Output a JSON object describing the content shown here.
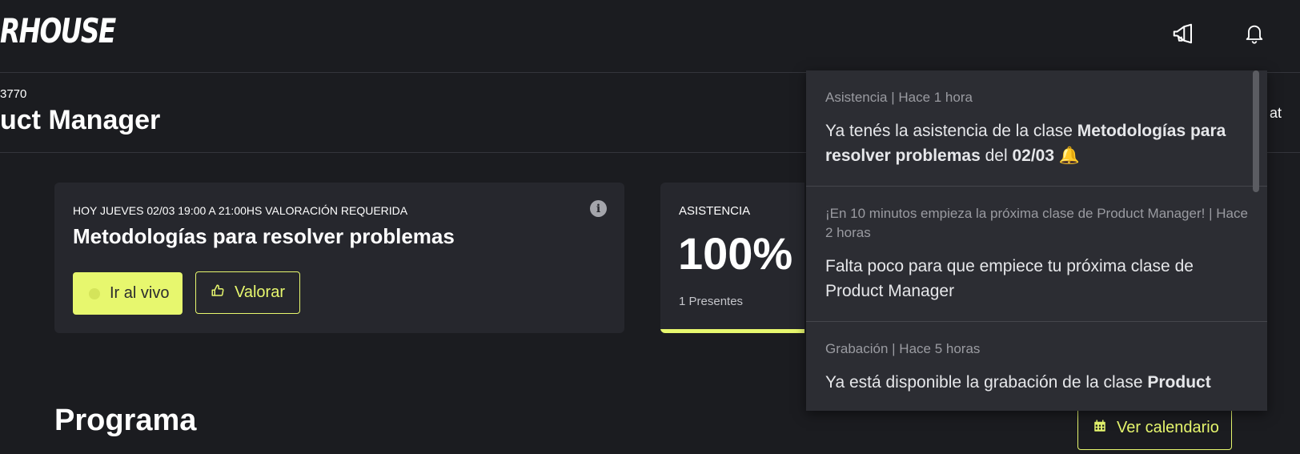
{
  "header": {
    "logo": "RHOUSE"
  },
  "course": {
    "code": "3770",
    "title": "uct Manager",
    "chat_cut": "at"
  },
  "class_card": {
    "meta": "HOY JUEVES 02/03 19:00 A 21:00HS VALORACIÓN REQUERIDA",
    "title": "Metodologías para resolver problemas",
    "live_label": "Ir al vivo",
    "rate_label": "Valorar"
  },
  "attendance": {
    "label": "ASISTENCIA",
    "value": "100%",
    "present": "1 Presentes",
    "progress": 1.0
  },
  "program": {
    "title": "Programa",
    "calendar_label": "Ver calendario"
  },
  "notifications": [
    {
      "meta": "Asistencia | Hace 1 hora",
      "parts": [
        "Ya tenés la asistencia de la clase ",
        "Metodologías para resolver problemas",
        " del ",
        "02/03",
        " 🔔"
      ]
    },
    {
      "meta": "¡En 10 minutos empieza la próxima clase de Product Manager! | Hace 2 horas",
      "parts": [
        "Falta poco para que empiece tu próxima clase de Product Manager"
      ]
    },
    {
      "meta": "Grabación | Hace 5 horas",
      "parts": [
        "Ya está disponible la grabación de la clase ",
        "Product"
      ]
    }
  ],
  "colors": {
    "accent": "#e7f76e",
    "background": "#1b1c20",
    "card": "#26272d"
  }
}
